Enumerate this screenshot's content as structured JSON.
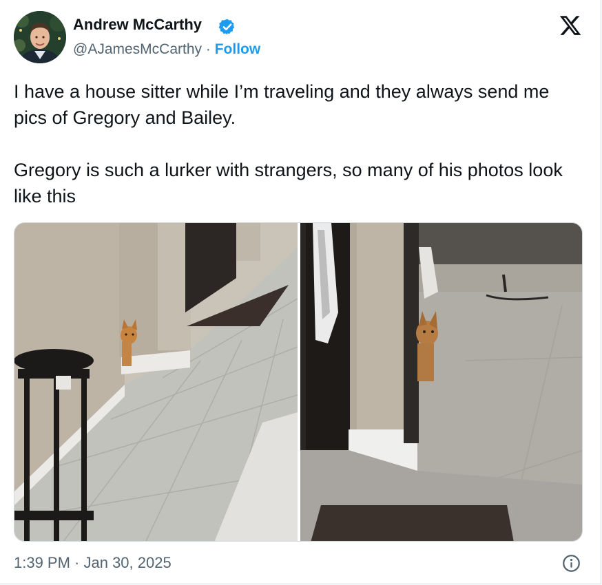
{
  "author": {
    "name": "Andrew McCarthy",
    "handle": "@AJamesMcCarthy",
    "separator": " · ",
    "follow_label": "Follow",
    "verified": true,
    "verified_color": "#1d9bf0"
  },
  "tweet": {
    "paragraphs": [
      "I have a house sitter while I’m traveling and they always send me pics of Gregory and Bailey.",
      "Gregory is such a lurker with strangers, so many of his photos look like this"
    ],
    "timestamp": "1:39 PM · Jan 30, 2025"
  },
  "icons": {
    "verified": "verified-badge-icon",
    "brand": "x-logo-icon",
    "info": "info-icon"
  },
  "colors": {
    "accent": "#1d9bf0",
    "text": "#0f1419",
    "secondary": "#536471",
    "border": "#cfd9de"
  }
}
